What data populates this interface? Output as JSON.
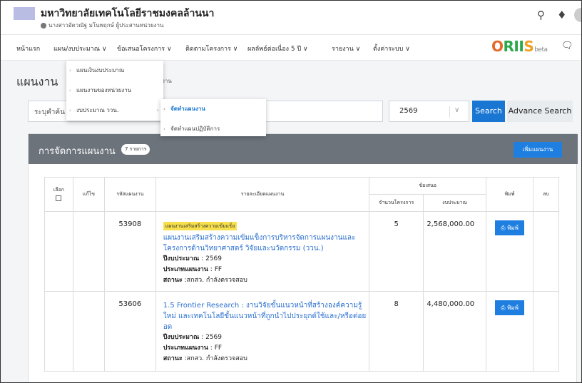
{
  "header": {
    "university": "มหาวิทยาลัยเทคโนโลยีราชมงคลล้านนา",
    "user": "นางสาวอัตวณัฐ มโนพฤกษ์ ผู้ประสานหน่วยงาน",
    "icons": [
      "search-icon",
      "bell-icon",
      "avatar"
    ]
  },
  "nav": {
    "items": [
      "หน้าแรก",
      "แผน/งบประมาณ ∨",
      "ข้อเสนอโครงการ ∨",
      "ติดตามโครงการ ∨",
      "ผลลัพธ์ต่อเนื่อง 5 ปี ∨",
      "รายงาน ∨",
      "ตั้งค่าระบบ ∨"
    ],
    "brand": {
      "o": "O",
      "rii": "RII",
      "s": "S",
      "beta": "beta"
    }
  },
  "page": {
    "title": "แผนงาน",
    "crumb_tail": "งาน"
  },
  "menu": {
    "main": [
      "แผนเงินงบประมาณ",
      "แผนงานของหน่วยงาน",
      "งบประมาณ ววน."
    ],
    "sub": [
      "จัดทำแผนงาน",
      "จัดทำแผนปฏิบัติการ"
    ]
  },
  "search": {
    "placeholder": "ระบุคำค้น",
    "year": "2569",
    "search_label": "Search",
    "advance_label": "Advance Search"
  },
  "card": {
    "title": "การจัดการแผนงาน",
    "count": "7 รายการ",
    "add_label": "เพิ่มแผนงาน"
  },
  "table": {
    "headers": {
      "select": "เลือก",
      "edit": "แก้ไข",
      "code": "รหัสแผนงาน",
      "detail": "รายละเอียดแผนงาน",
      "proposal": "ข้อเสนอ",
      "count": "จำนวนโครงการ",
      "budget": "งบประมาณ",
      "print": "พิมพ์",
      "delete": "ลบ"
    },
    "labels": {
      "year": "ปีงบประมาณ",
      "type": "ประเภทแผนงาน",
      "status": "สถานะ",
      "print_btn": "พิมพ์"
    },
    "rows": [
      {
        "code": "53908",
        "tag": "แผนงานเสริมสร้างความเข้มแข็ง",
        "title": "แผนงานเสริมสร้างความเข้มแข็งการบริหารจัดการแผนงานและโครงการด้านวิทยาศาสตร์ วิจัยและนวัตกรรม (ววน.)",
        "year": " : 2569",
        "type": " : FF",
        "status": " :สกสว. กำลังตรวจสอบ",
        "count": "5",
        "budget": "2,568,000.00"
      },
      {
        "code": "53606",
        "tag": "",
        "title": "1.5 Frontier Research : งานวิจัยขั้นแนวหน้าที่สร้างองค์ความรู้ใหม่ และเทคโนโลยีขั้นแนวหน้าที่ถูกนำไปประยุกต์ใช้และ/หรือต่อยอด",
        "year": " : 2569",
        "type": " : FF",
        "status": " :สกสว. กำลังตรวจสอบ",
        "count": "8",
        "budget": "4,480,000.00"
      }
    ]
  }
}
